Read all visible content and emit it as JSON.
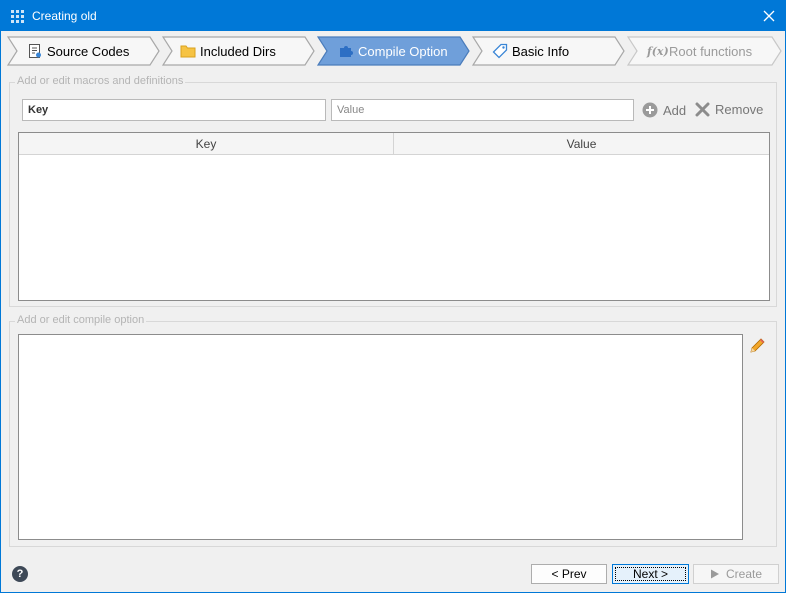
{
  "window": {
    "title": "Creating old",
    "accent_color": "#0078d7"
  },
  "steps": [
    {
      "label": "Source Codes",
      "icon": "source-code-icon",
      "state": "done"
    },
    {
      "label": "Included Dirs",
      "icon": "folder-icon",
      "state": "done"
    },
    {
      "label": "Compile Option",
      "icon": "puzzle-icon",
      "state": "active"
    },
    {
      "label": "Basic Info",
      "icon": "tag-icon",
      "state": "done"
    },
    {
      "label": "Root functions",
      "icon": "function-icon",
      "state": "disabled"
    }
  ],
  "macros": {
    "group_label": "Add or edit macros and definitions",
    "key_value": "Key",
    "value_placeholder": "Value",
    "add_label": "Add",
    "remove_label": "Remove",
    "columns": [
      "Key",
      "Value"
    ],
    "rows": []
  },
  "compile": {
    "group_label": "Add or edit compile option",
    "value": "",
    "edit_icon": "pencil-icon"
  },
  "footer": {
    "help_label": "?",
    "prev_label": "< Prev",
    "next_label": "Next >",
    "create_label": "Create"
  }
}
